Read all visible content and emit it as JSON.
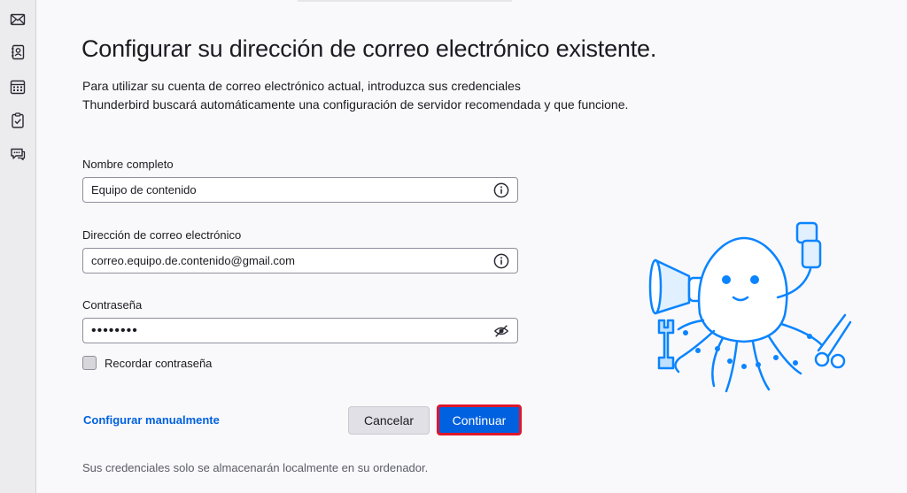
{
  "colors": {
    "accent": "#0061e0",
    "highlight_border": "#e0162b",
    "sidebar_bg": "#ececef"
  },
  "spaces_toolbar": {
    "items": [
      {
        "icon": "mail-icon"
      },
      {
        "icon": "address-book-icon"
      },
      {
        "icon": "calendar-icon"
      },
      {
        "icon": "tasks-icon"
      },
      {
        "icon": "chat-icon"
      }
    ]
  },
  "setup": {
    "title": "Configurar su dirección de correo electrónico existente.",
    "intro_line1": "Para utilizar su cuenta de correo electrónico actual, introduzca sus credenciales",
    "intro_line2": "Thunderbird buscará automáticamente una configuración de servidor recomendada y que funcione.",
    "name_label": "Nombre completo",
    "name_value": "Equipo de contenido",
    "email_label": "Dirección de correo electrónico",
    "email_value": "correo.equipo.de.contenido@gmail.com",
    "password_label": "Contraseña",
    "password_value": "••••••••",
    "remember_label": "Recordar contraseña",
    "remember_checked": false,
    "manual_link": "Configurar manualmente",
    "cancel_label": "Cancelar",
    "continue_label": "Continuar",
    "footnote": "Sus credenciales solo se almacenarán localmente en su ordenador."
  }
}
